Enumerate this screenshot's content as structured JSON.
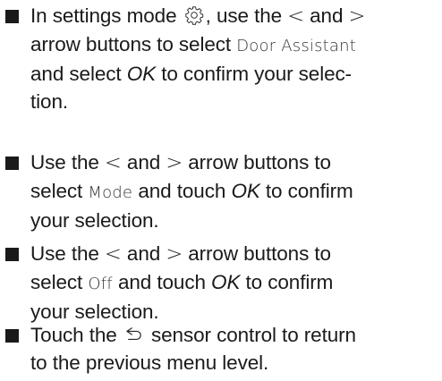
{
  "steps": [
    {
      "parts": [
        {
          "t": "In settings mode "
        },
        {
          "icon": "gear-icon"
        },
        {
          "t": ", use the "
        },
        {
          "sym": "<"
        },
        {
          "t": " and "
        },
        {
          "sym": ">"
        },
        {
          "br": true
        },
        {
          "t": "arrow buttons to select "
        },
        {
          "disp": "Door Assistant"
        },
        {
          "br": true
        },
        {
          "t": "and select "
        },
        {
          "em": "OK"
        },
        {
          "t": " to confirm your selec-"
        },
        {
          "br": true
        },
        {
          "t": "tion."
        }
      ]
    },
    {
      "parts": [
        {
          "t": "Use the "
        },
        {
          "sym": "<"
        },
        {
          "t": " and "
        },
        {
          "sym": ">"
        },
        {
          "t": " arrow buttons to"
        },
        {
          "br": true
        },
        {
          "t": "select "
        },
        {
          "disp": "Mode"
        },
        {
          "t": " and touch "
        },
        {
          "em": "OK"
        },
        {
          "t": " to confirm"
        },
        {
          "br": true
        },
        {
          "t": "your selection."
        }
      ]
    },
    {
      "parts": [
        {
          "t": "Use the "
        },
        {
          "sym": "<"
        },
        {
          "t": " and "
        },
        {
          "sym": ">"
        },
        {
          "t": " arrow buttons to"
        },
        {
          "br": true
        },
        {
          "t": "select "
        },
        {
          "disp": "Off"
        },
        {
          "t": " and touch "
        },
        {
          "em": "OK"
        },
        {
          "t": " to confirm"
        },
        {
          "br": true
        },
        {
          "t": "your selection."
        }
      ]
    },
    {
      "parts": [
        {
          "t": "Touch the "
        },
        {
          "icon": "back-arrow-icon"
        },
        {
          "t": " sensor control to return"
        },
        {
          "br": true
        },
        {
          "t": "to the previous menu level."
        }
      ]
    }
  ]
}
